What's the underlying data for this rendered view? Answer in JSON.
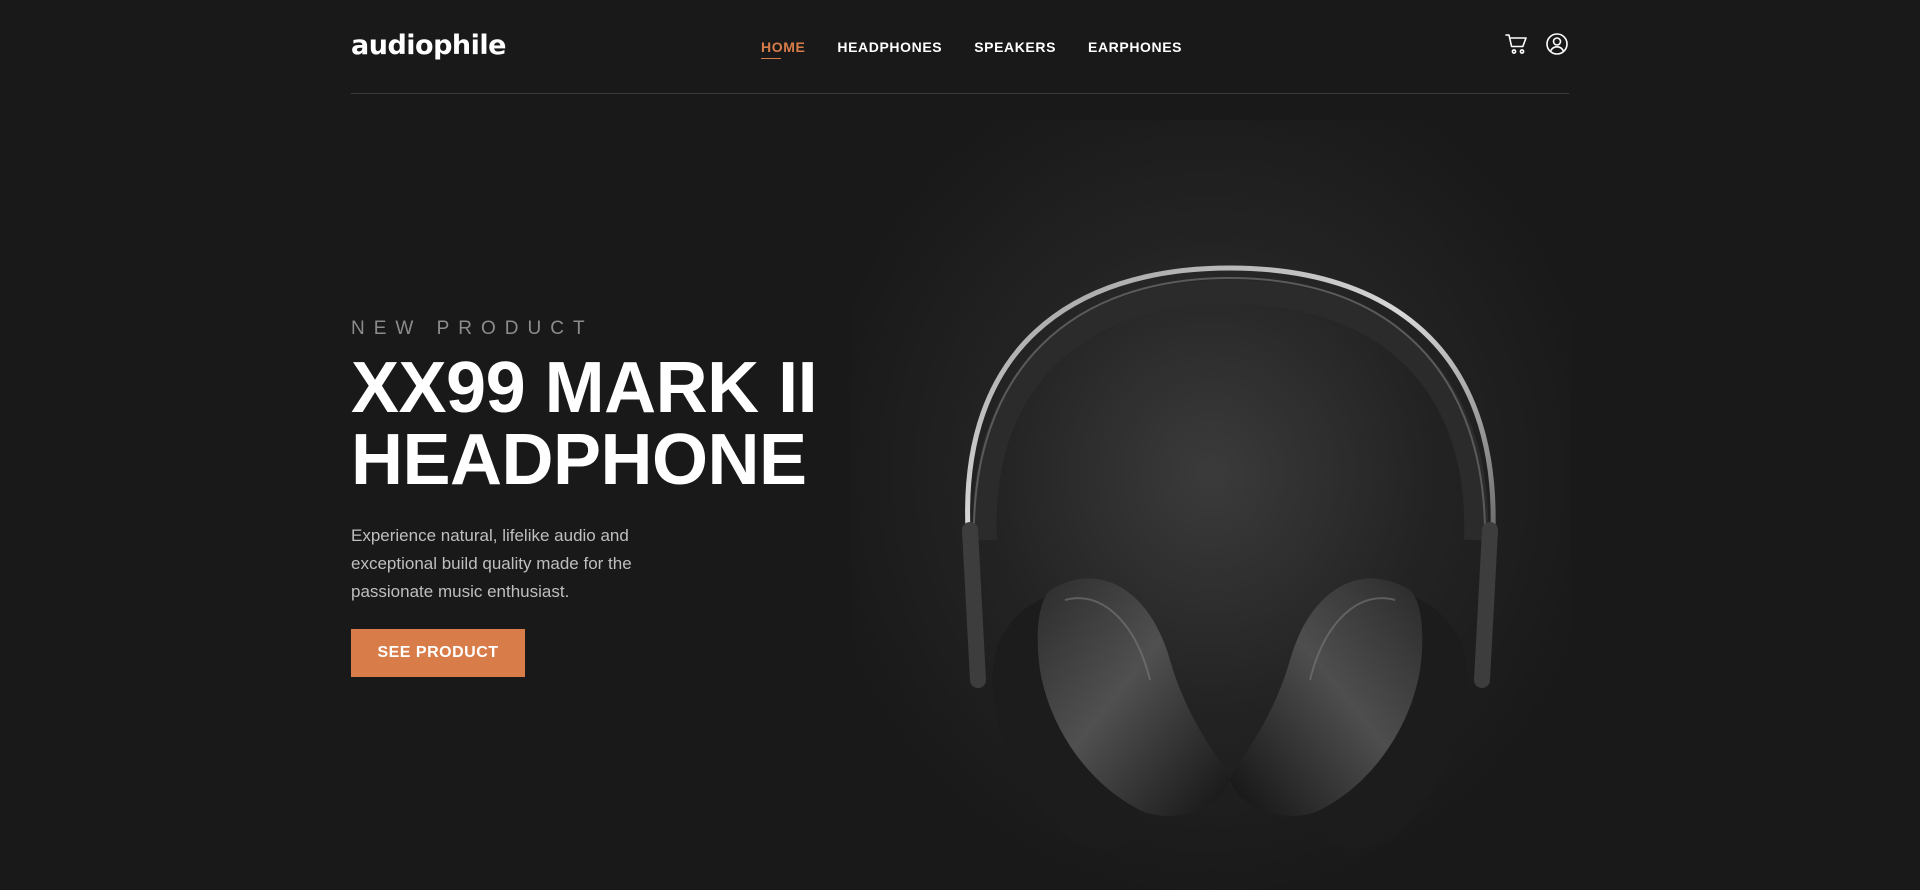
{
  "brand": {
    "logo": "audiophile"
  },
  "nav": {
    "items": [
      {
        "label": "HOME",
        "active": true
      },
      {
        "label": "HEADPHONES",
        "active": false
      },
      {
        "label": "SPEAKERS",
        "active": false
      },
      {
        "label": "EARPHONES",
        "active": false
      }
    ]
  },
  "header_icons": [
    "cart-icon",
    "user-icon"
  ],
  "hero": {
    "overline": "NEW PRODUCT",
    "title_line1": "XX99 MARK II",
    "title_line2": "HEADPHONE",
    "description": "Experience natural, lifelike audio and exceptional build quality made for the passionate music enthusiast.",
    "cta_label": "SEE PRODUCT"
  },
  "colors": {
    "background": "#191919",
    "accent": "#d87d4a",
    "text": "#ffffff",
    "muted": "#8c8c8c"
  }
}
